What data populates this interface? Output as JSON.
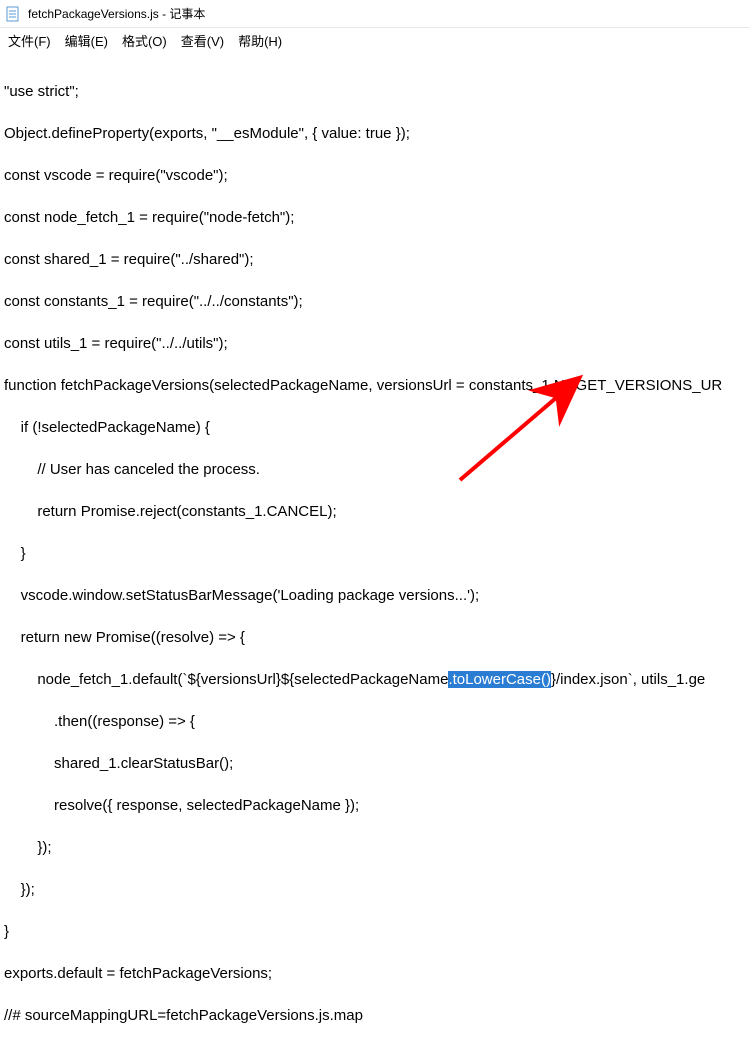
{
  "title": "fetchPackageVersions.js - 记事本",
  "menu": {
    "file": "文件(F)",
    "edit": "编辑(E)",
    "format": "格式(O)",
    "view": "查看(V)",
    "help": "帮助(H)"
  },
  "code": {
    "l1": "\"use strict\";",
    "l2": "Object.defineProperty(exports, \"__esModule\", { value: true });",
    "l3": "const vscode = require(\"vscode\");",
    "l4": "const node_fetch_1 = require(\"node-fetch\");",
    "l5": "const shared_1 = require(\"../shared\");",
    "l6": "const constants_1 = require(\"../../constants\");",
    "l7": "const utils_1 = require(\"../../utils\");",
    "l8": "function fetchPackageVersions(selectedPackageName, versionsUrl = constants_1.NUGET_VERSIONS_UR",
    "l9": "    if (!selectedPackageName) {",
    "l10": "        // User has canceled the process.",
    "l11": "        return Promise.reject(constants_1.CANCEL);",
    "l12": "    }",
    "l13": "    vscode.window.setStatusBarMessage('Loading package versions...');",
    "l14": "    return new Promise((resolve) => {",
    "l15a": "        node_fetch_1.default(`${versionsUrl}${selectedPackageName",
    "l15h": ".toLowerCase()",
    "l15b": "}/index.json`, utils_1.ge",
    "l16": "            .then((response) => {",
    "l17": "            shared_1.clearStatusBar();",
    "l18": "            resolve({ response, selectedPackageName });",
    "l19": "        });",
    "l20": "    });",
    "l21": "}",
    "l22": "exports.default = fetchPackageVersions;",
    "l23": "//# sourceMappingURL=fetchPackageVersions.js.map"
  }
}
